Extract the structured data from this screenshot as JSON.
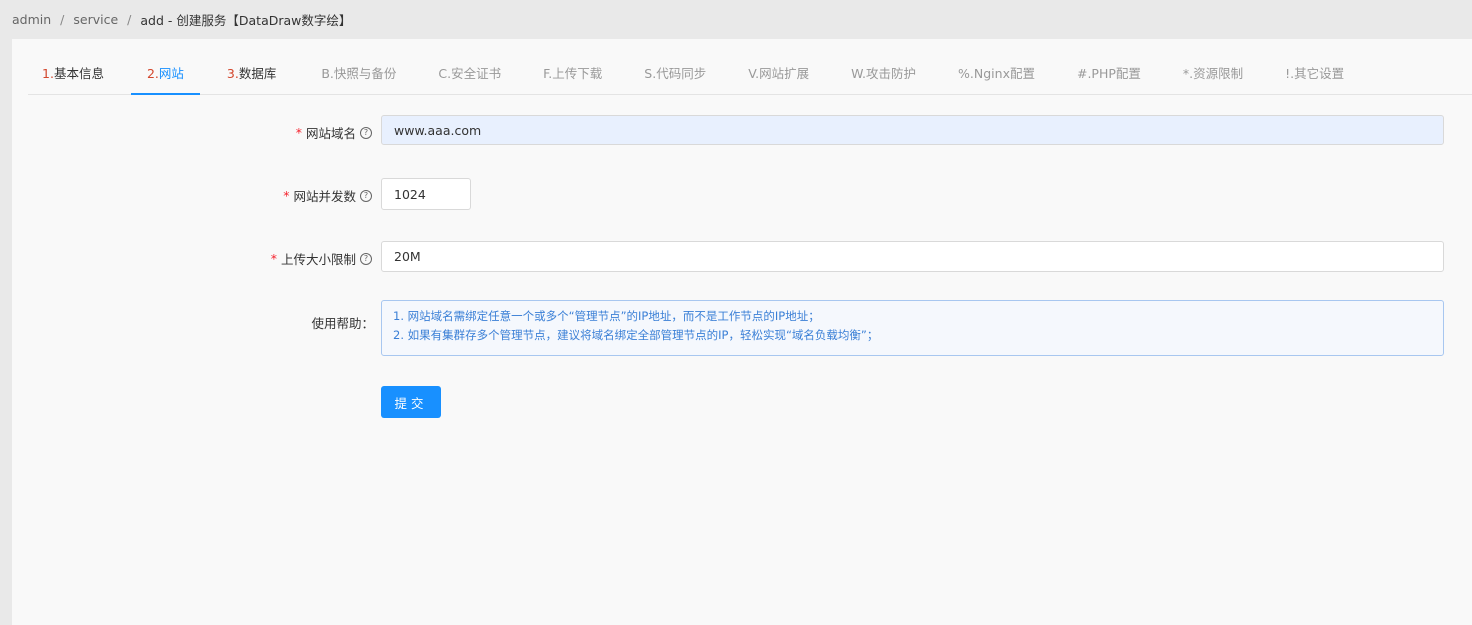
{
  "breadcrumb": {
    "items": [
      "admin",
      "service"
    ],
    "current": "add - 创建服务【DataDraw数字绘】"
  },
  "tabs": [
    {
      "num": "1.",
      "label": "基本信息",
      "state": "done"
    },
    {
      "num": "2.",
      "label": "网站",
      "state": "active"
    },
    {
      "num": "3.",
      "label": "数据库",
      "state": "done"
    },
    {
      "num": "",
      "label": "B.快照与备份",
      "state": "pending"
    },
    {
      "num": "",
      "label": "C.安全证书",
      "state": "pending"
    },
    {
      "num": "",
      "label": "F.上传下载",
      "state": "pending"
    },
    {
      "num": "",
      "label": "S.代码同步",
      "state": "pending"
    },
    {
      "num": "",
      "label": "V.网站扩展",
      "state": "pending"
    },
    {
      "num": "",
      "label": "W.攻击防护",
      "state": "pending"
    },
    {
      "num": "",
      "label": "%.Nginx配置",
      "state": "pending"
    },
    {
      "num": "",
      "label": "#.PHP配置",
      "state": "pending"
    },
    {
      "num": "",
      "label": "*.资源限制",
      "state": "pending"
    },
    {
      "num": "",
      "label": "!.其它设置",
      "state": "pending"
    }
  ],
  "form": {
    "domain": {
      "label": "网站域名",
      "value": "www.aaa.com"
    },
    "concurrency": {
      "label": "网站并发数",
      "value": "1024"
    },
    "upload_limit": {
      "label": "上传大小限制",
      "value": "20M"
    },
    "help": {
      "label": "使用帮助：",
      "lines": [
        "1. 网站域名需绑定任意一个或多个“管理节点”的IP地址，而不是工作节点的IP地址；",
        "2. 如果有集群存多个管理节点，建议将域名绑定全部管理节点的IP，轻松实现“域名负载均衡”；"
      ]
    },
    "submit_label": "提交"
  },
  "colors": {
    "accent": "#1890ff",
    "required": "#f5222d",
    "step_number": "#d3472d"
  }
}
